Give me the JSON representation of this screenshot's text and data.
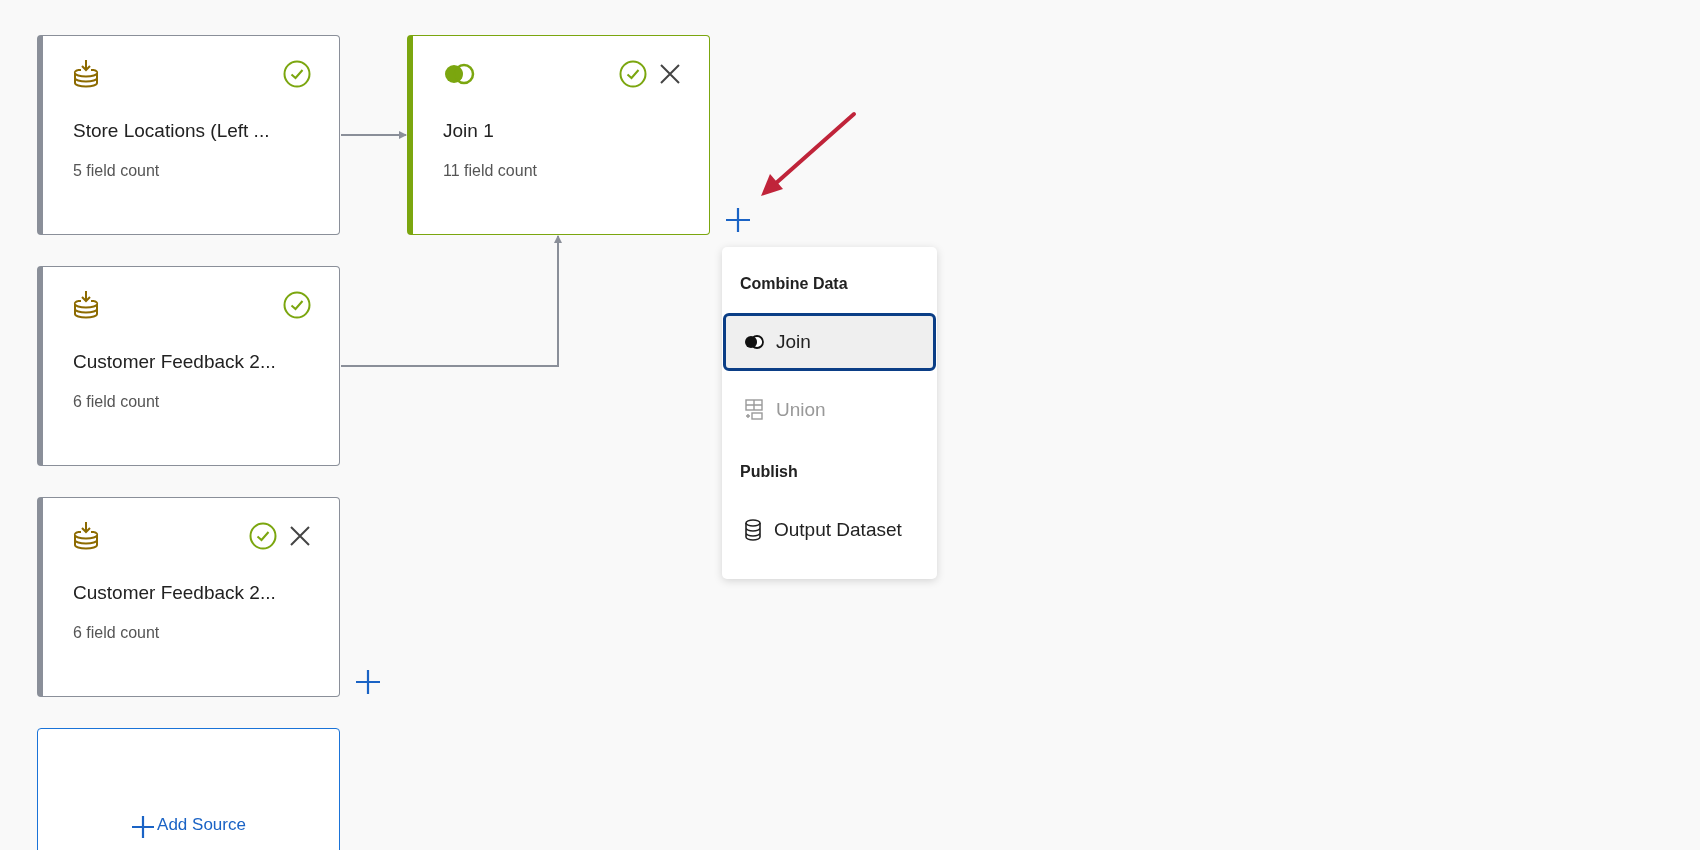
{
  "nodes": [
    {
      "kind": "source",
      "title": "Store Locations (Left ...",
      "subtitle": "5 field count",
      "valid": true,
      "removable": false,
      "add_button": false
    },
    {
      "kind": "source",
      "title": "Customer Feedback 2...",
      "subtitle": "6 field count",
      "valid": true,
      "removable": false,
      "add_button": false
    },
    {
      "kind": "source",
      "title": "Customer Feedback 2...",
      "subtitle": "6 field count",
      "valid": true,
      "removable": true,
      "add_button": true
    },
    {
      "kind": "join",
      "title": "Join 1",
      "subtitle": "11 field count",
      "valid": true,
      "removable": true,
      "add_button": true
    }
  ],
  "add_source": {
    "label": "Add Source"
  },
  "menu": {
    "sections": [
      {
        "heading": "Combine Data",
        "items": [
          {
            "kind": "join",
            "label": "Join",
            "selected": true,
            "disabled": false
          },
          {
            "kind": "union",
            "label": "Union",
            "selected": false,
            "disabled": true
          }
        ]
      },
      {
        "heading": "Publish",
        "items": [
          {
            "kind": "dataset",
            "label": "Output Dataset",
            "selected": false,
            "disabled": false
          }
        ]
      }
    ]
  }
}
